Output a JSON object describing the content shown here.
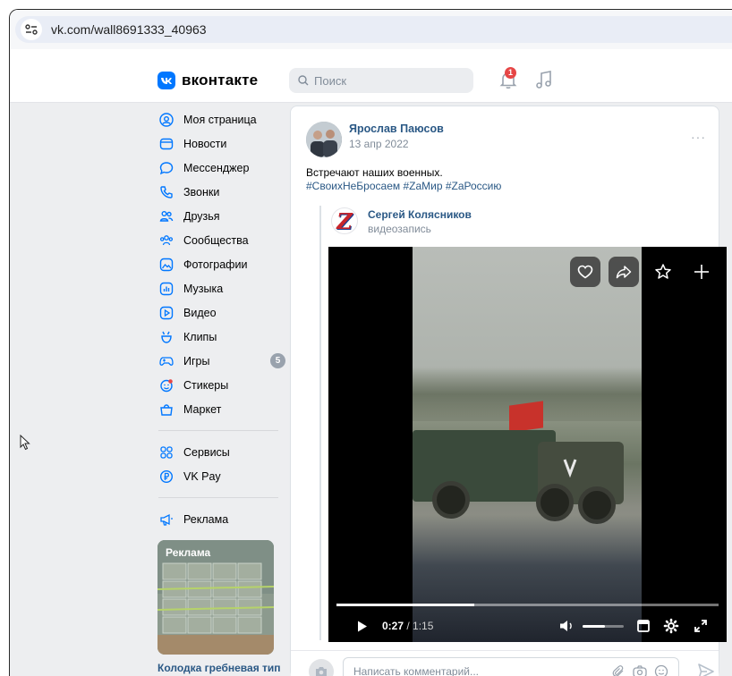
{
  "browser": {
    "url": "vk.com/wall8691333_40963"
  },
  "header": {
    "logo_text": "вконтакте",
    "logo_letters": "vk",
    "search_placeholder": "Поиск",
    "notification_count": "1",
    "accent": "#0077ff"
  },
  "sidebar": {
    "items": [
      {
        "label": "Моя страница",
        "icon": "profile-icon"
      },
      {
        "label": "Новости",
        "icon": "news-icon"
      },
      {
        "label": "Мессенджер",
        "icon": "messenger-icon"
      },
      {
        "label": "Звонки",
        "icon": "phone-icon"
      },
      {
        "label": "Друзья",
        "icon": "friends-icon"
      },
      {
        "label": "Сообщества",
        "icon": "communities-icon"
      },
      {
        "label": "Фотографии",
        "icon": "photos-icon"
      },
      {
        "label": "Музыка",
        "icon": "music-icon"
      },
      {
        "label": "Видео",
        "icon": "video-icon"
      },
      {
        "label": "Клипы",
        "icon": "clips-icon"
      },
      {
        "label": "Игры",
        "icon": "games-icon",
        "count": "5"
      },
      {
        "label": "Стикеры",
        "icon": "stickers-icon"
      },
      {
        "label": "Маркет",
        "icon": "market-icon"
      }
    ],
    "items2": [
      {
        "label": "Сервисы",
        "icon": "services-icon"
      },
      {
        "label": "VK Pay",
        "icon": "vkpay-icon"
      }
    ],
    "items3": [
      {
        "label": "Реклама",
        "icon": "ads-icon"
      }
    ],
    "ad": {
      "label": "Реклама",
      "title": "Колодка гребневая тип М"
    }
  },
  "post": {
    "author": "Ярослав Паюсов",
    "date": "13 апр 2022",
    "text": "Встречают наших военных.",
    "hashtags": "#СвоихНеБросаем #ZaМир #ZaРоссию",
    "more": "···",
    "repost": {
      "author": "Сергей Колясников",
      "subtitle": "видеозапись",
      "avatar_letter": "Z"
    },
    "video": {
      "current_time": "0:27",
      "separator": " / ",
      "total_time": "1:15",
      "progress": 0.36,
      "volume": 0.55
    },
    "comment_placeholder": "Написать комментарий..."
  }
}
